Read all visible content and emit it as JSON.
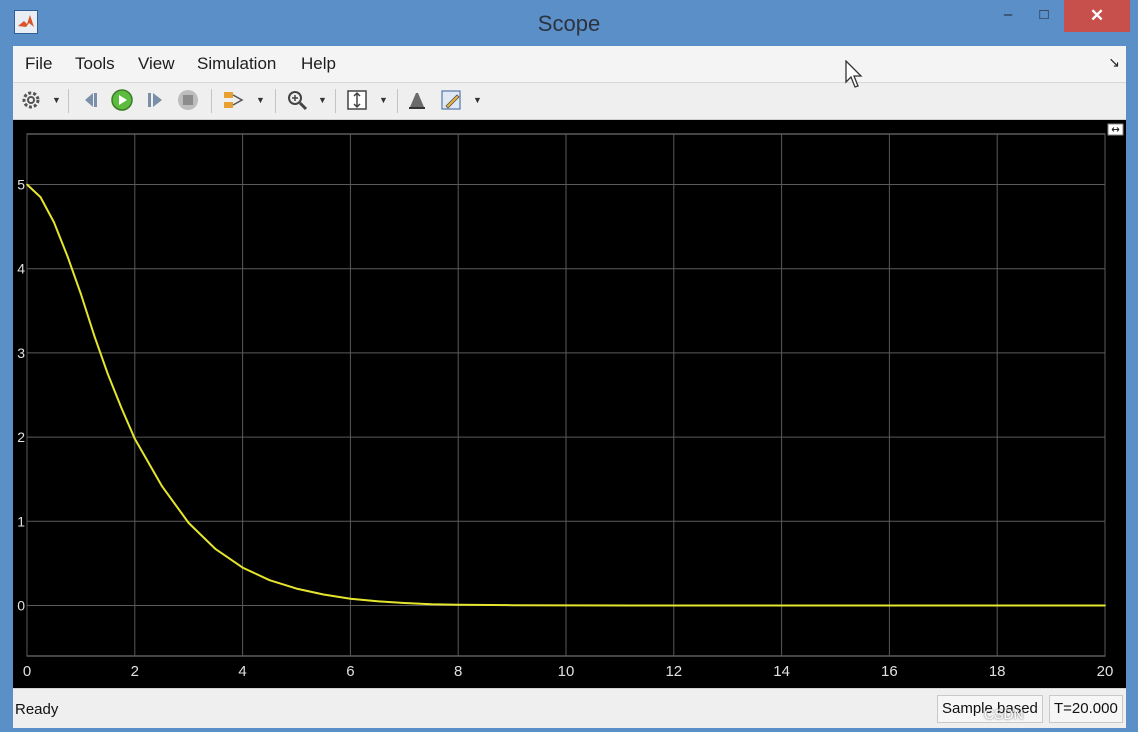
{
  "window": {
    "title": "Scope",
    "watermark": "CSDN",
    "controls": {
      "minimize": "–",
      "maximize": "□",
      "close": "✕"
    }
  },
  "menu": {
    "items": [
      "File",
      "Tools",
      "View",
      "Simulation",
      "Help"
    ],
    "overflow_icon": "dock-arrow-icon"
  },
  "toolbar": {
    "icons": [
      "settings-icon",
      "step-back-icon",
      "run-icon",
      "step-forward-icon",
      "stop-icon",
      "signal-selector-icon",
      "zoom-in-icon",
      "autoscale-icon",
      "highlight-icon",
      "edit-icon"
    ]
  },
  "colors": {
    "plot_bg": "#000000",
    "grid": "#5a5a5a",
    "axis_text": "#e0e0e0",
    "trace": "#e5e52e",
    "titlebar": "#5b8fc8"
  },
  "chart_data": {
    "type": "line",
    "title": "",
    "xlabel": "",
    "ylabel": "",
    "xlim": [
      0,
      20
    ],
    "ylim": [
      -0.6,
      5.6
    ],
    "grid": true,
    "x_ticks": [
      0,
      2,
      4,
      6,
      8,
      10,
      12,
      14,
      16,
      18,
      20
    ],
    "y_ticks": [
      0,
      1,
      2,
      3,
      4,
      5
    ],
    "series": [
      {
        "x": [
          0,
          0.25,
          0.5,
          0.75,
          1,
          1.25,
          1.5,
          1.75,
          2,
          2.5,
          3,
          3.5,
          4,
          4.5,
          5,
          5.5,
          6,
          6.5,
          7,
          7.5,
          8,
          9,
          10,
          12,
          14,
          16,
          18,
          20
        ],
        "values": [
          5.0,
          4.85,
          4.55,
          4.15,
          3.7,
          3.2,
          2.75,
          2.35,
          1.98,
          1.42,
          0.98,
          0.67,
          0.45,
          0.3,
          0.2,
          0.13,
          0.08,
          0.05,
          0.03,
          0.015,
          0.008,
          0.003,
          0.001,
          0,
          0,
          0,
          0,
          0
        ]
      }
    ]
  },
  "status": {
    "ready": "Ready",
    "sample_based": "Sample based",
    "time": "T=20.000"
  }
}
